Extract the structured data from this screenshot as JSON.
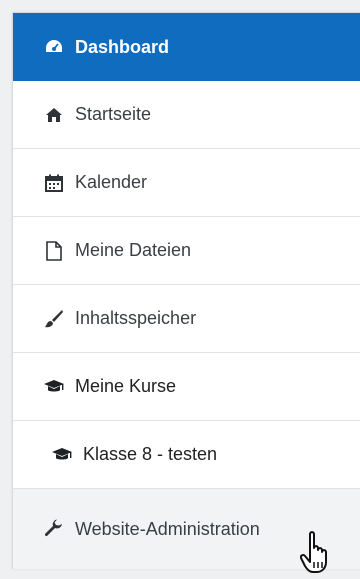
{
  "nav": {
    "items": [
      {
        "label": "Dashboard",
        "icon": "dashboard-icon"
      },
      {
        "label": "Startseite",
        "icon": "home-icon"
      },
      {
        "label": "Kalender",
        "icon": "calendar-icon"
      },
      {
        "label": "Meine Dateien",
        "icon": "file-icon"
      },
      {
        "label": "Inhaltsspeicher",
        "icon": "brush-icon"
      },
      {
        "label": "Meine Kurse",
        "icon": "graduation-cap-icon"
      },
      {
        "label": "Klasse 8 - testen",
        "icon": "graduation-cap-icon"
      },
      {
        "label": "Website-Administration",
        "icon": "wrench-icon"
      }
    ]
  },
  "colors": {
    "active_background": "#0f6cbf",
    "active_text": "#ffffff",
    "text": "#3a3f44",
    "hover_background": "#f2f3f5"
  },
  "cursor": {
    "icon": "hand-pointer-icon"
  }
}
